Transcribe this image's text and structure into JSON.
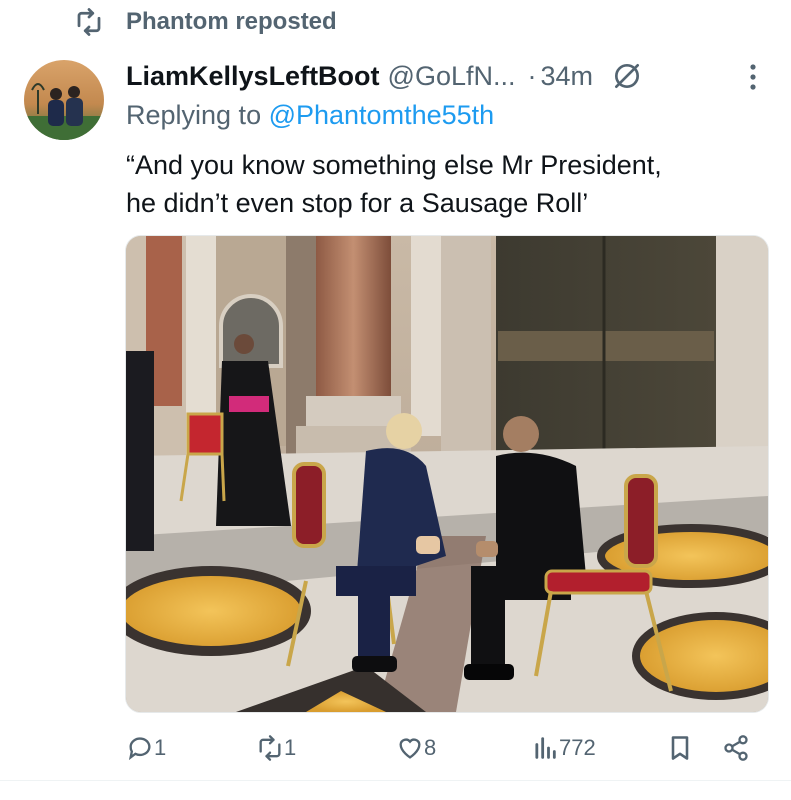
{
  "repost": {
    "text": "Phantom reposted",
    "icon": "repost-icon"
  },
  "tweet": {
    "display_name": "LiamKellysLeftBoot",
    "handle": "@GoLfN...",
    "separator": "·",
    "time": "34m",
    "replying_prefix": "Replying to ",
    "replying_to": "@Phantomthe55th",
    "text_line1": "“And you know something else Mr President,",
    "text_line2": "he didn’t even stop for a Sausage Roll’"
  },
  "actions": {
    "replies": "1",
    "reposts": "1",
    "likes": "8",
    "views": "772"
  },
  "colors": {
    "secondary": "#536471",
    "link": "#1d9bf0",
    "text": "#0f1419"
  }
}
